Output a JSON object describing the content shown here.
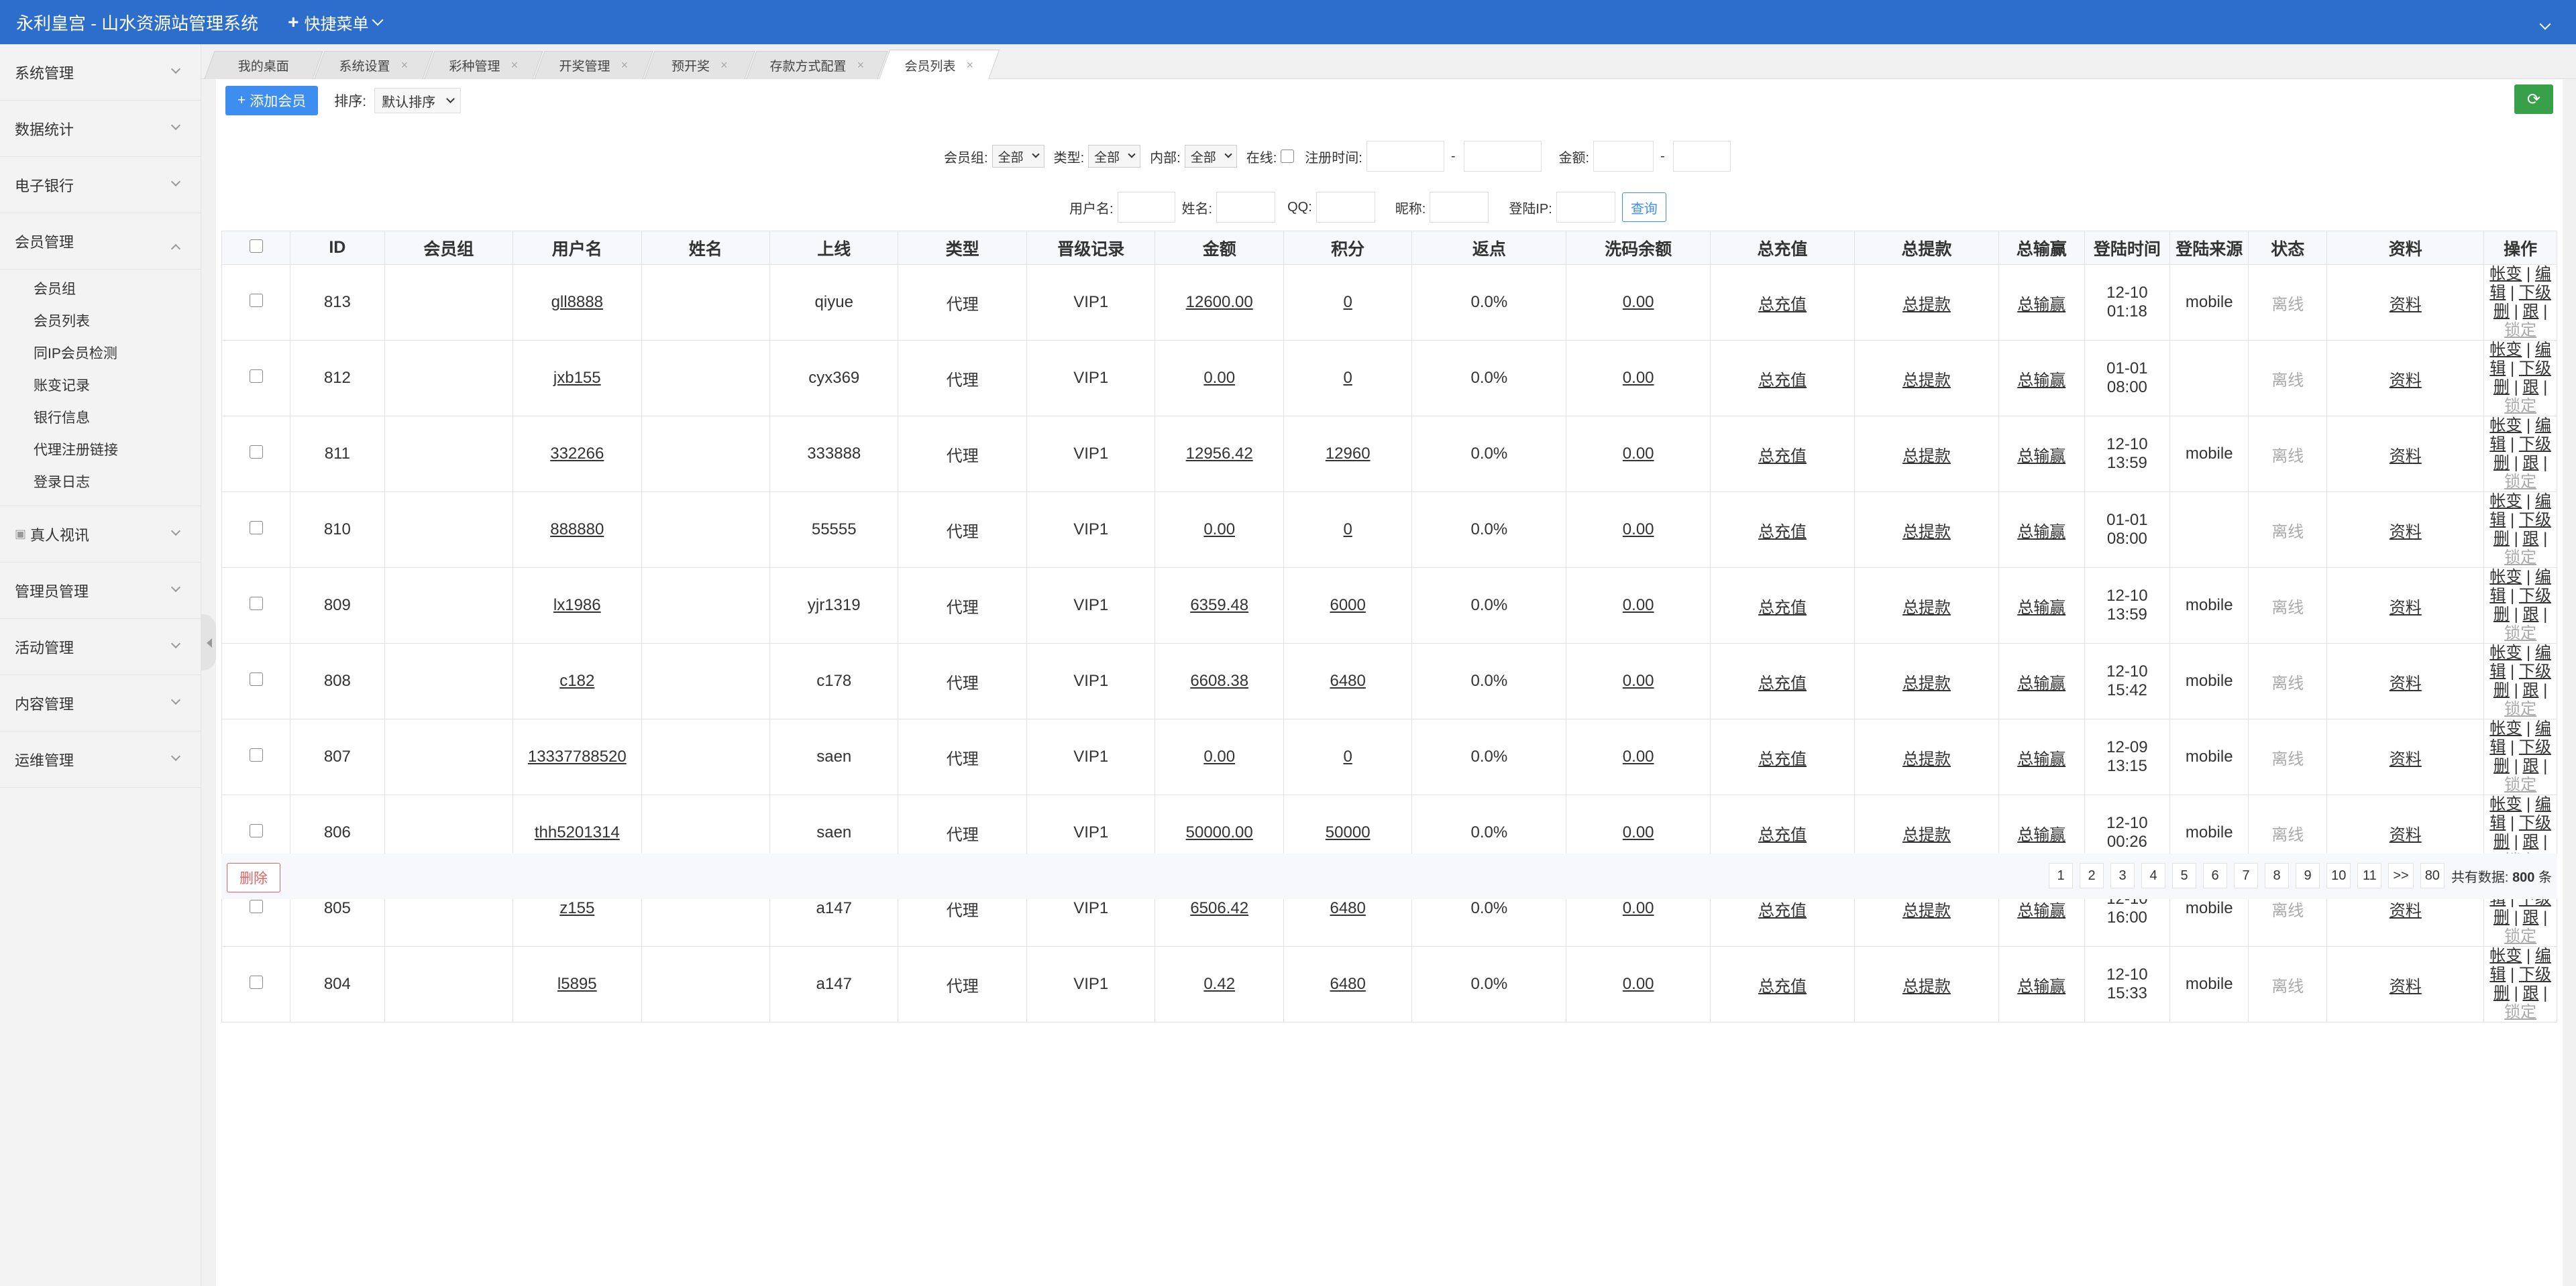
{
  "app": {
    "title": "永利皇宫 - 山水资源站管理系统",
    "quick_menu": "快捷菜单"
  },
  "sidebar": {
    "groups": [
      {
        "label": "系统管理"
      },
      {
        "label": "数据统计"
      },
      {
        "label": "电子银行"
      },
      {
        "label": "会员管理",
        "expanded": true
      },
      {
        "label": "真人视讯"
      },
      {
        "label": "管理员管理"
      },
      {
        "label": "活动管理"
      },
      {
        "label": "内容管理"
      },
      {
        "label": "运维管理"
      }
    ],
    "member_sub": [
      "会员组",
      "会员列表",
      "同IP会员检测",
      "账变记录",
      "银行信息",
      "代理注册链接",
      "登录日志"
    ]
  },
  "tabs": [
    {
      "label": "我的桌面"
    },
    {
      "label": "系统设置"
    },
    {
      "label": "彩种管理"
    },
    {
      "label": "开奖管理"
    },
    {
      "label": "预开奖"
    },
    {
      "label": "存款方式配置"
    },
    {
      "label": "会员列表",
      "active": true
    }
  ],
  "toolbar": {
    "add_label": "添加会员",
    "sort_label": "排序:",
    "sort_value": "默认排序"
  },
  "filters": {
    "group_label": "会员组:",
    "group_value": "全部",
    "type_label": "类型:",
    "type_value": "全部",
    "internal_label": "内部:",
    "internal_value": "全部",
    "online_label": "在线:",
    "regtime_label": "注册时间:",
    "dash": "-",
    "amount_label": "金额:",
    "username_label": "用户名:",
    "name_label": "姓名:",
    "qq_label": "QQ:",
    "nickname_label": "昵称:",
    "ip_label": "登陆IP:",
    "query_label": "查询"
  },
  "table": {
    "headers": [
      "ID",
      "会员组",
      "用户名",
      "姓名",
      "上线",
      "类型",
      "晋级记录",
      "金额",
      "积分",
      "返点",
      "洗码余额",
      "总充值",
      "总提款",
      "总输赢",
      "登陆时间",
      "登陆来源",
      "状态",
      "资料",
      "操作"
    ],
    "rows": [
      {
        "id": "813",
        "group": "",
        "username": "gll8888",
        "name": "",
        "upline": "qiyue",
        "type": "代理",
        "level": "VIP1",
        "amount": "12600.00",
        "points": "0",
        "rebate": "0.0%",
        "wash": "0.00",
        "recharge": "总充值",
        "withdraw": "总提款",
        "winloss": "总输赢",
        "login_time": "12-10 01:18",
        "source": "mobile",
        "status": "离线",
        "info": "资料"
      },
      {
        "id": "812",
        "group": "",
        "username": "jxb155",
        "name": "",
        "upline": "cyx369",
        "type": "代理",
        "level": "VIP1",
        "amount": "0.00",
        "points": "0",
        "rebate": "0.0%",
        "wash": "0.00",
        "recharge": "总充值",
        "withdraw": "总提款",
        "winloss": "总输赢",
        "login_time": "01-01 08:00",
        "source": "",
        "status": "离线",
        "info": "资料"
      },
      {
        "id": "811",
        "group": "",
        "username": "332266",
        "name": "",
        "upline": "333888",
        "type": "代理",
        "level": "VIP1",
        "amount": "12956.42",
        "points": "12960",
        "rebate": "0.0%",
        "wash": "0.00",
        "recharge": "总充值",
        "withdraw": "总提款",
        "winloss": "总输赢",
        "login_time": "12-10 13:59",
        "source": "mobile",
        "status": "离线",
        "info": "资料"
      },
      {
        "id": "810",
        "group": "",
        "username": "888880",
        "name": "",
        "upline": "55555",
        "type": "代理",
        "level": "VIP1",
        "amount": "0.00",
        "points": "0",
        "rebate": "0.0%",
        "wash": "0.00",
        "recharge": "总充值",
        "withdraw": "总提款",
        "winloss": "总输赢",
        "login_time": "01-01 08:00",
        "source": "",
        "status": "离线",
        "info": "资料"
      },
      {
        "id": "809",
        "group": "",
        "username": "lx1986",
        "name": "",
        "upline": "yjr1319",
        "type": "代理",
        "level": "VIP1",
        "amount": "6359.48",
        "points": "6000",
        "rebate": "0.0%",
        "wash": "0.00",
        "recharge": "总充值",
        "withdraw": "总提款",
        "winloss": "总输赢",
        "login_time": "12-10 13:59",
        "source": "mobile",
        "status": "离线",
        "info": "资料"
      },
      {
        "id": "808",
        "group": "",
        "username": "c182",
        "name": "",
        "upline": "c178",
        "type": "代理",
        "level": "VIP1",
        "amount": "6608.38",
        "points": "6480",
        "rebate": "0.0%",
        "wash": "0.00",
        "recharge": "总充值",
        "withdraw": "总提款",
        "winloss": "总输赢",
        "login_time": "12-10 15:42",
        "source": "mobile",
        "status": "离线",
        "info": "资料"
      },
      {
        "id": "807",
        "group": "",
        "username": "13337788520",
        "name": "",
        "upline": "saen",
        "type": "代理",
        "level": "VIP1",
        "amount": "0.00",
        "points": "0",
        "rebate": "0.0%",
        "wash": "0.00",
        "recharge": "总充值",
        "withdraw": "总提款",
        "winloss": "总输赢",
        "login_time": "12-09 13:15",
        "source": "mobile",
        "status": "离线",
        "info": "资料"
      },
      {
        "id": "806",
        "group": "",
        "username": "thh5201314",
        "name": "",
        "upline": "saen",
        "type": "代理",
        "level": "VIP1",
        "amount": "50000.00",
        "points": "50000",
        "rebate": "0.0%",
        "wash": "0.00",
        "recharge": "总充值",
        "withdraw": "总提款",
        "winloss": "总输赢",
        "login_time": "12-10 00:26",
        "source": "mobile",
        "status": "离线",
        "info": "资料"
      },
      {
        "id": "805",
        "group": "",
        "username": "z155",
        "name": "",
        "upline": "a147",
        "type": "代理",
        "level": "VIP1",
        "amount": "6506.42",
        "points": "6480",
        "rebate": "0.0%",
        "wash": "0.00",
        "recharge": "总充值",
        "withdraw": "总提款",
        "winloss": "总输赢",
        "login_time": "12-10 16:00",
        "source": "mobile",
        "status": "离线",
        "info": "资料"
      },
      {
        "id": "804",
        "group": "",
        "username": "l5895",
        "name": "",
        "upline": "a147",
        "type": "代理",
        "level": "VIP1",
        "amount": "0.42",
        "points": "6480",
        "rebate": "0.0%",
        "wash": "0.00",
        "recharge": "总充值",
        "withdraw": "总提款",
        "winloss": "总输赢",
        "login_time": "12-10 15:33",
        "source": "mobile",
        "status": "离线",
        "info": "资料"
      }
    ],
    "ops": {
      "account_change": "帐变",
      "sep": "|",
      "edit": "编辑",
      "downline": "下级",
      "delete": "删",
      "follow": "跟",
      "lock": "锁定"
    }
  },
  "footer": {
    "delete_label": "删除",
    "pages": [
      "1",
      "2",
      "3",
      "4",
      "5",
      "6",
      "7",
      "8",
      "9",
      "10",
      "11",
      ">>",
      "80"
    ],
    "total_prefix": "共有数据:",
    "total_count": "800",
    "total_suffix": "条"
  }
}
